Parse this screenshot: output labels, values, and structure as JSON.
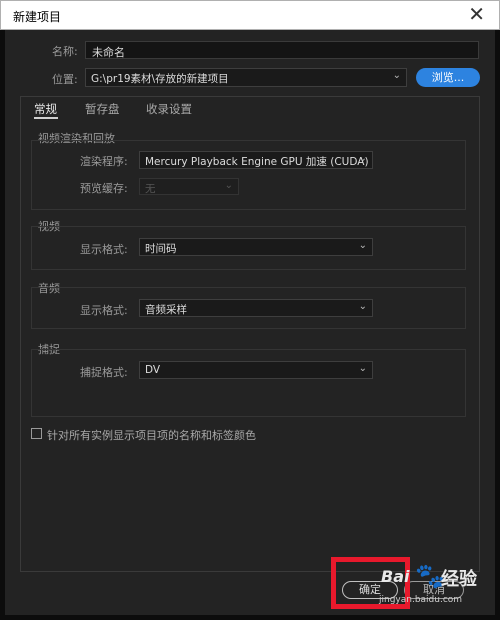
{
  "window": {
    "title": "新建项目",
    "close_glyph": "✕"
  },
  "name_row": {
    "label": "名称:",
    "value": "未命名"
  },
  "location_row": {
    "label": "位置:",
    "value": "G:\\pr19素材\\存放的新建项目",
    "browse_label": "浏览..."
  },
  "tabs": [
    {
      "label": "常规",
      "active": true
    },
    {
      "label": "暂存盘",
      "active": false
    },
    {
      "label": "收录设置",
      "active": false
    }
  ],
  "render_section": {
    "title": "视频渲染和回放",
    "renderer_label": "渲染程序:",
    "renderer_value": "Mercury Playback Engine GPU 加速 (CUDA)",
    "preview_cache_label": "预览缓存:",
    "preview_cache_value": "无"
  },
  "video_section": {
    "title": "视频",
    "display_format_label": "显示格式:",
    "display_format_value": "时间码"
  },
  "audio_section": {
    "title": "音频",
    "display_format_label": "显示格式:",
    "display_format_value": "音频采样"
  },
  "capture_section": {
    "title": "捕捉",
    "capture_format_label": "捕捉格式:",
    "capture_format_value": "DV"
  },
  "checkbox": {
    "label": "针对所有实例显示项目项的名称和标签颜色",
    "checked": false
  },
  "buttons": {
    "ok": "确定",
    "cancel": "取消"
  },
  "watermark": {
    "brand": "Bai",
    "paw": "🐾",
    "text": "经验",
    "url": "jingyan.baidu.com"
  },
  "colors": {
    "accent": "#2d83e0",
    "highlight": "#e8192c",
    "background": "#232323"
  }
}
